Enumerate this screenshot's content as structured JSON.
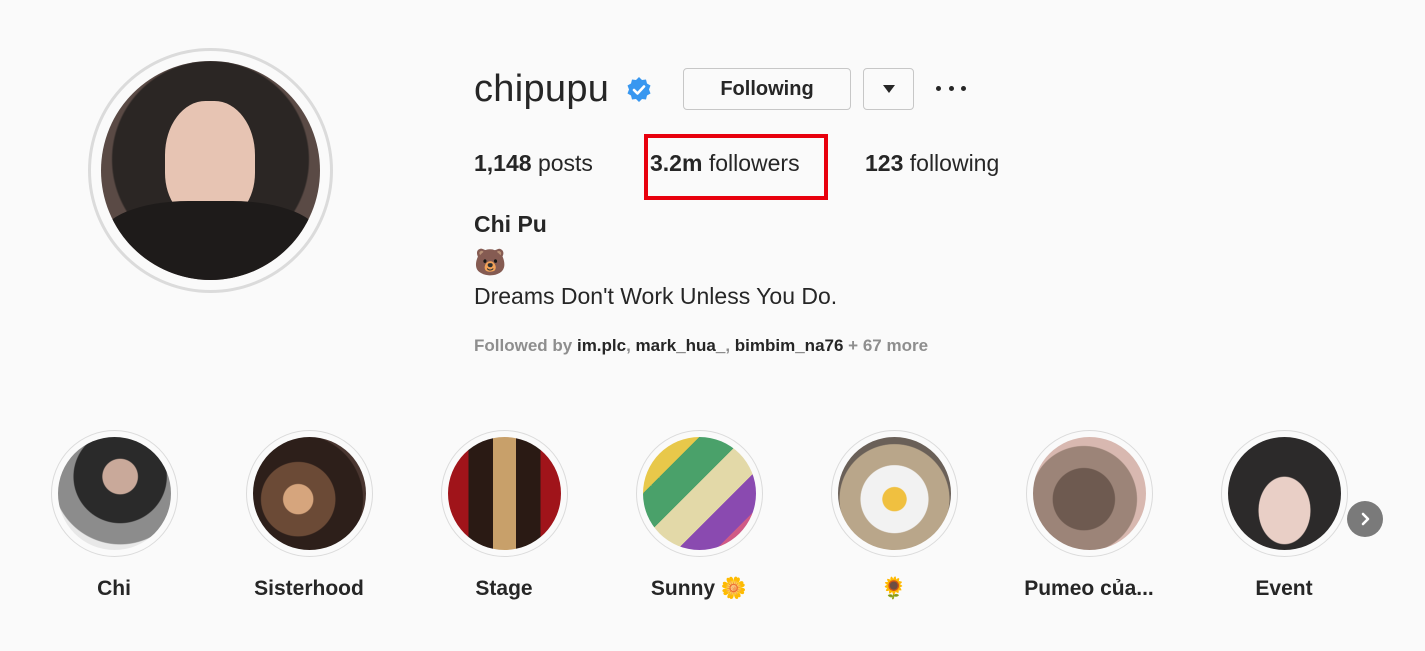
{
  "profile": {
    "username": "chipupu",
    "verified": true,
    "verified_icon": "verified-badge-icon",
    "following_label": "Following",
    "dropdown_icon": "caret-down-icon",
    "more_icon": "more-options-icon"
  },
  "stats": {
    "posts_count": "1,148",
    "posts_label": "posts",
    "followers_count": "3.2m",
    "followers_label": "followers",
    "following_count": "123",
    "following_label": "following"
  },
  "bio": {
    "full_name": "Chi Pu",
    "emoji": "🐻",
    "text": "Dreams Don't Work Unless You Do.",
    "followed_by_prefix": "Followed by",
    "followed_by_accounts": [
      "im.plc",
      "mark_hua_",
      "bimbim_na76"
    ],
    "followed_by_more": "+ 67 more"
  },
  "highlights": [
    {
      "label": "Chi"
    },
    {
      "label": "Sisterhood"
    },
    {
      "label": "Stage"
    },
    {
      "label": "Sunny 🌼"
    },
    {
      "label": "🌻"
    },
    {
      "label": "Pumeo của..."
    },
    {
      "label": "Event"
    }
  ],
  "annotation": {
    "highlight_color": "#e8000d"
  },
  "colors": {
    "verified_blue": "#3897f0",
    "background": "#fafafa",
    "text": "#262626",
    "muted": "#8e8e8e"
  }
}
